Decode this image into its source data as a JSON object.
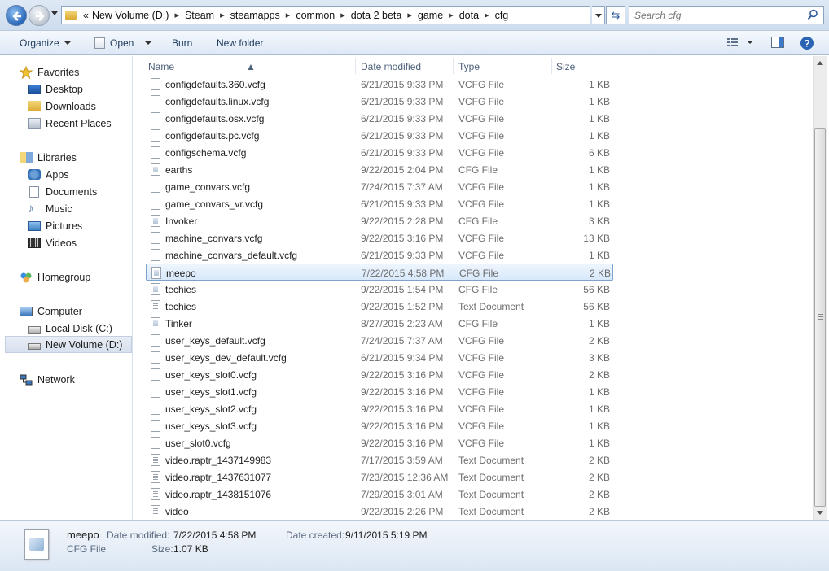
{
  "address": {
    "overflow": "«",
    "crumbs": [
      "New Volume (D:)",
      "Steam",
      "steamapps",
      "common",
      "dota 2 beta",
      "game",
      "dota",
      "cfg"
    ],
    "search_placeholder": "Search cfg"
  },
  "toolbar": {
    "organize": "Organize",
    "open": "Open",
    "burn": "Burn",
    "new_folder": "New folder"
  },
  "nav": {
    "favorites": "Favorites",
    "desktop": "Desktop",
    "downloads": "Downloads",
    "recent": "Recent Places",
    "libraries": "Libraries",
    "apps": "Apps",
    "documents": "Documents",
    "music": "Music",
    "pictures": "Pictures",
    "videos": "Videos",
    "homegroup": "Homegroup",
    "computer": "Computer",
    "local_disk": "Local Disk (C:)",
    "new_volume": "New Volume (D:)",
    "network": "Network"
  },
  "columns": {
    "name": "Name",
    "date": "Date modified",
    "type": "Type",
    "size": "Size"
  },
  "files": [
    {
      "name": "configdefaults.360.vcfg",
      "date": "6/21/2015 9:33 PM",
      "type": "VCFG File",
      "size": "1 KB"
    },
    {
      "name": "configdefaults.linux.vcfg",
      "date": "6/21/2015 9:33 PM",
      "type": "VCFG File",
      "size": "1 KB"
    },
    {
      "name": "configdefaults.osx.vcfg",
      "date": "6/21/2015 9:33 PM",
      "type": "VCFG File",
      "size": "1 KB"
    },
    {
      "name": "configdefaults.pc.vcfg",
      "date": "6/21/2015 9:33 PM",
      "type": "VCFG File",
      "size": "1 KB"
    },
    {
      "name": "configschema.vcfg",
      "date": "6/21/2015 9:33 PM",
      "type": "VCFG File",
      "size": "6 KB"
    },
    {
      "name": "earths",
      "date": "9/22/2015 2:04 PM",
      "type": "CFG File",
      "size": "1 KB"
    },
    {
      "name": "game_convars.vcfg",
      "date": "7/24/2015 7:37 AM",
      "type": "VCFG File",
      "size": "1 KB"
    },
    {
      "name": "game_convars_vr.vcfg",
      "date": "6/21/2015 9:33 PM",
      "type": "VCFG File",
      "size": "1 KB"
    },
    {
      "name": "Invoker",
      "date": "9/22/2015 2:28 PM",
      "type": "CFG File",
      "size": "3 KB"
    },
    {
      "name": "machine_convars.vcfg",
      "date": "9/22/2015 3:16 PM",
      "type": "VCFG File",
      "size": "13 KB"
    },
    {
      "name": "machine_convars_default.vcfg",
      "date": "6/21/2015 9:33 PM",
      "type": "VCFG File",
      "size": "1 KB"
    },
    {
      "name": "meepo",
      "date": "7/22/2015 4:58 PM",
      "type": "CFG File",
      "size": "2 KB"
    },
    {
      "name": "techies",
      "date": "9/22/2015 1:54 PM",
      "type": "CFG File",
      "size": "56 KB"
    },
    {
      "name": "techies",
      "date": "9/22/2015 1:52 PM",
      "type": "Text Document",
      "size": "56 KB"
    },
    {
      "name": "Tinker",
      "date": "8/27/2015 2:23 AM",
      "type": "CFG File",
      "size": "1 KB"
    },
    {
      "name": "user_keys_default.vcfg",
      "date": "7/24/2015 7:37 AM",
      "type": "VCFG File",
      "size": "2 KB"
    },
    {
      "name": "user_keys_dev_default.vcfg",
      "date": "6/21/2015 9:34 PM",
      "type": "VCFG File",
      "size": "3 KB"
    },
    {
      "name": "user_keys_slot0.vcfg",
      "date": "9/22/2015 3:16 PM",
      "type": "VCFG File",
      "size": "2 KB"
    },
    {
      "name": "user_keys_slot1.vcfg",
      "date": "9/22/2015 3:16 PM",
      "type": "VCFG File",
      "size": "1 KB"
    },
    {
      "name": "user_keys_slot2.vcfg",
      "date": "9/22/2015 3:16 PM",
      "type": "VCFG File",
      "size": "1 KB"
    },
    {
      "name": "user_keys_slot3.vcfg",
      "date": "9/22/2015 3:16 PM",
      "type": "VCFG File",
      "size": "1 KB"
    },
    {
      "name": "user_slot0.vcfg",
      "date": "9/22/2015 3:16 PM",
      "type": "VCFG File",
      "size": "1 KB"
    },
    {
      "name": "video.raptr_1437149983",
      "date": "7/17/2015 3:59 AM",
      "type": "Text Document",
      "size": "2 KB"
    },
    {
      "name": "video.raptr_1437631077",
      "date": "7/23/2015 12:36 AM",
      "type": "Text Document",
      "size": "2 KB"
    },
    {
      "name": "video.raptr_1438151076",
      "date": "7/29/2015 3:01 AM",
      "type": "Text Document",
      "size": "2 KB"
    },
    {
      "name": "video",
      "date": "9/22/2015 2:26 PM",
      "type": "Text Document",
      "size": "2 KB"
    }
  ],
  "selected_index": 11,
  "details": {
    "name": "meepo",
    "type": "CFG File",
    "date_modified_label": "Date modified:",
    "date_modified": "7/22/2015 4:58 PM",
    "date_created_label": "Date created:",
    "date_created": "9/11/2015 5:19 PM",
    "size_label": "Size:",
    "size": "1.07 KB"
  },
  "colors": {
    "selection_border": "#7da2ce",
    "selection_fill": "#d8e9fb",
    "toolbar_text": "#1e395b"
  }
}
